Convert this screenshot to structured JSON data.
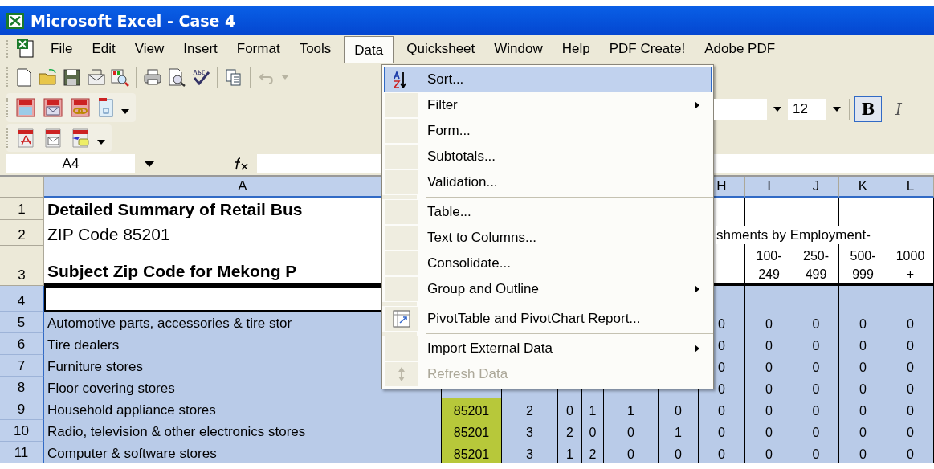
{
  "window": {
    "title": "Microsoft Excel - Case 4"
  },
  "menu_bar": [
    {
      "label": "File",
      "selected": false
    },
    {
      "label": "Edit",
      "selected": false
    },
    {
      "label": "View",
      "selected": false
    },
    {
      "label": "Insert",
      "selected": false
    },
    {
      "label": "Format",
      "selected": false
    },
    {
      "label": "Tools",
      "selected": false
    },
    {
      "label": "Data",
      "selected": true
    },
    {
      "label": "Quicksheet",
      "selected": false
    },
    {
      "label": "Window",
      "selected": false
    },
    {
      "label": "Help",
      "selected": false
    },
    {
      "label": "PDF Create!",
      "selected": false
    },
    {
      "label": "Adobe PDF",
      "selected": false
    }
  ],
  "toolbar": {
    "undo": {
      "disabled": true
    },
    "font_size": "12",
    "format_buttons": [
      {
        "label": "B",
        "selected": true
      },
      {
        "label": "I",
        "selected": false
      }
    ]
  },
  "formula_bar": {
    "name_box": "A4"
  },
  "data_menu": [
    {
      "kind": "sort",
      "label": "Sort...",
      "selected": true,
      "submenu": false,
      "disabled": false
    },
    {
      "kind": "command",
      "label": "Filter",
      "selected": false,
      "submenu": true,
      "disabled": false
    },
    {
      "kind": "command",
      "label": "Form...",
      "selected": false,
      "submenu": false,
      "disabled": false
    },
    {
      "kind": "command",
      "label": "Subtotals...",
      "selected": false,
      "submenu": false,
      "disabled": false
    },
    {
      "kind": "command",
      "label": "Validation...",
      "selected": false,
      "submenu": false,
      "disabled": false
    },
    {
      "kind": "separator"
    },
    {
      "kind": "command",
      "label": "Table...",
      "selected": false,
      "submenu": false,
      "disabled": false
    },
    {
      "kind": "command",
      "label": "Text to Columns...",
      "selected": false,
      "submenu": false,
      "disabled": false
    },
    {
      "kind": "command",
      "label": "Consolidate...",
      "selected": false,
      "submenu": false,
      "disabled": false
    },
    {
      "kind": "command",
      "label": "Group and Outline",
      "selected": false,
      "submenu": true,
      "disabled": false
    },
    {
      "kind": "separator"
    },
    {
      "kind": "pivot",
      "label": "PivotTable and PivotChart Report...",
      "selected": false,
      "submenu": false,
      "disabled": false
    },
    {
      "kind": "separator"
    },
    {
      "kind": "command",
      "label": "Import External Data",
      "selected": false,
      "submenu": true,
      "disabled": false
    },
    {
      "kind": "refresh",
      "label": "Refresh Data",
      "selected": false,
      "submenu": false,
      "disabled": true
    }
  ],
  "sheet": {
    "column_headers": {
      "A": {
        "label": "A",
        "selected": true
      },
      "H": {
        "label": "H",
        "selected": true
      },
      "I": {
        "label": "I",
        "selected": true
      },
      "J": {
        "label": "J",
        "selected": true
      },
      "K": {
        "label": "K",
        "selected": true
      },
      "L": {
        "label": "L",
        "selected": true
      }
    },
    "rows": [
      {
        "header": "1",
        "selected": false,
        "kind": "title",
        "cells": {
          "A": "Detailed Summary of Retail Bus"
        }
      },
      {
        "header": "2",
        "selected": false,
        "kind": "subtitle",
        "cells": {
          "A": "ZIP Code 85201",
          "H": "shments by Employment-"
        }
      },
      {
        "header": "3",
        "selected": false,
        "kind": "heading",
        "cells": {
          "A": "Subject Zip Code for Mekong P",
          "I": "100-\n249",
          "J": "250-\n499",
          "K": "500-\n999",
          "L": "1000\n+"
        }
      },
      {
        "header": "4",
        "selected": true,
        "active": true,
        "kind": "data",
        "cells": {}
      },
      {
        "header": "5",
        "selected": true,
        "kind": "data",
        "cells": {
          "A": "Automotive parts, accessories & tire stor",
          "H": "0",
          "I": "0",
          "J": "0",
          "K": "0",
          "L": "0"
        }
      },
      {
        "header": "6",
        "selected": true,
        "kind": "data",
        "cells": {
          "A": "Tire dealers",
          "H": "0",
          "I": "0",
          "J": "0",
          "K": "0",
          "L": "0"
        }
      },
      {
        "header": "7",
        "selected": true,
        "kind": "data",
        "cells": {
          "A": "Furniture stores",
          "H": "0",
          "I": "0",
          "J": "0",
          "K": "0",
          "L": "0"
        }
      },
      {
        "header": "8",
        "selected": true,
        "kind": "data",
        "cells": {
          "A": "Floor covering stores",
          "H": "0",
          "I": "0",
          "J": "0",
          "K": "0",
          "L": "0"
        }
      },
      {
        "header": "9",
        "selected": true,
        "kind": "data",
        "cells": {
          "A": "Household appliance stores",
          "B": "85201",
          "C": "2",
          "D": "0",
          "E": "1",
          "F": "1",
          "G": "0",
          "H": "0",
          "I": "0",
          "J": "0",
          "K": "0",
          "L": "0"
        }
      },
      {
        "header": "10",
        "selected": true,
        "kind": "data",
        "cells": {
          "A": "Radio, television & other electronics stores",
          "B": "85201",
          "C": "3",
          "D": "2",
          "E": "0",
          "F": "0",
          "G": "1",
          "H": "0",
          "I": "0",
          "J": "0",
          "K": "0",
          "L": "0"
        }
      },
      {
        "header": "11",
        "selected": true,
        "kind": "data",
        "cells": {
          "A": "Computer & software stores",
          "B": "85201",
          "C": "3",
          "D": "1",
          "E": "2",
          "F": "0",
          "G": "0",
          "H": "0",
          "I": "0",
          "J": "0",
          "K": "0",
          "L": "0"
        }
      }
    ]
  }
}
